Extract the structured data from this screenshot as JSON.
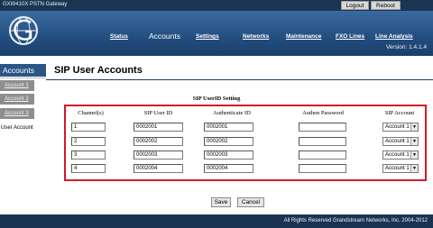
{
  "app": {
    "name": "GXW410X PSTN Gateway",
    "version": "Version: 1.4.1.4"
  },
  "top_buttons": {
    "logout": "Logout",
    "reboot": "Reboot"
  },
  "nav": [
    {
      "label": "Status"
    },
    {
      "label": "Accounts"
    },
    {
      "label": "Settings"
    },
    {
      "label": "Networks"
    },
    {
      "label": "Maintenance"
    },
    {
      "label": "FXO Lines"
    },
    {
      "label": "Line Analysis"
    }
  ],
  "sidebar": {
    "title": "Accounts",
    "items": [
      {
        "label": "Account 1"
      },
      {
        "label": "Account 2"
      },
      {
        "label": "Account 3"
      },
      {
        "label": "User Account"
      }
    ]
  },
  "page": {
    "title": "SIP User Accounts",
    "section_title": "SIP UserID Setting"
  },
  "table": {
    "headers": [
      "Channel(s)",
      "SIP User ID",
      "Authenticate ID",
      "Authen Password",
      "SIP Account"
    ],
    "rows": [
      {
        "channel": "1",
        "user_id": "0002001",
        "auth_id": "0002001",
        "password": "",
        "account": "Account 1"
      },
      {
        "channel": "2",
        "user_id": "0002002",
        "auth_id": "0002002",
        "password": "",
        "account": "Account 1"
      },
      {
        "channel": "3",
        "user_id": "0002003",
        "auth_id": "0002003",
        "password": "",
        "account": "Account 1"
      },
      {
        "channel": "4",
        "user_id": "0002004",
        "auth_id": "0002004",
        "password": "",
        "account": "Account 1"
      }
    ]
  },
  "actions": {
    "save": "Save",
    "cancel": "Cancel"
  },
  "footer": {
    "text": "All Rights Reserved Grandstream Networks, Inc. 2004-2012"
  },
  "colors": {
    "header": "#2a5586",
    "footer": "#1b3352",
    "highlight_box": "#d11a2a"
  }
}
